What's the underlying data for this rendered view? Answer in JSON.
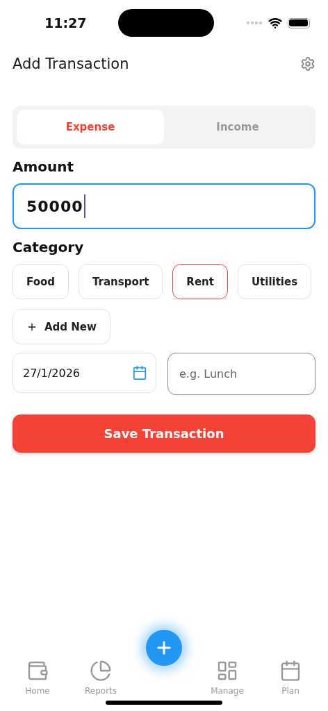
{
  "status_bar": {
    "time": "11:27"
  },
  "header": {
    "title": "Add Transaction"
  },
  "type_tabs": [
    {
      "label": "Expense",
      "selected": true
    },
    {
      "label": "Income",
      "selected": false
    }
  ],
  "amount": {
    "label": "Amount",
    "value": "50000"
  },
  "category": {
    "label": "Category",
    "chips": [
      {
        "label": "Food",
        "selected": false
      },
      {
        "label": "Transport",
        "selected": false
      },
      {
        "label": "Rent",
        "selected": true
      },
      {
        "label": "Utilities",
        "selected": false
      }
    ],
    "add_label": "Add New"
  },
  "date": {
    "value": "27/1/2026"
  },
  "note": {
    "placeholder": "e.g. Lunch"
  },
  "save_button": "Save Transaction",
  "bottom_nav": [
    {
      "label": "Home",
      "kind": "wallet",
      "selected": false
    },
    {
      "label": "Reports",
      "kind": "pie",
      "selected": false
    },
    {
      "label": "Manage",
      "kind": "layout",
      "selected": false
    },
    {
      "label": "Plan",
      "kind": "calendar",
      "selected": false
    }
  ]
}
